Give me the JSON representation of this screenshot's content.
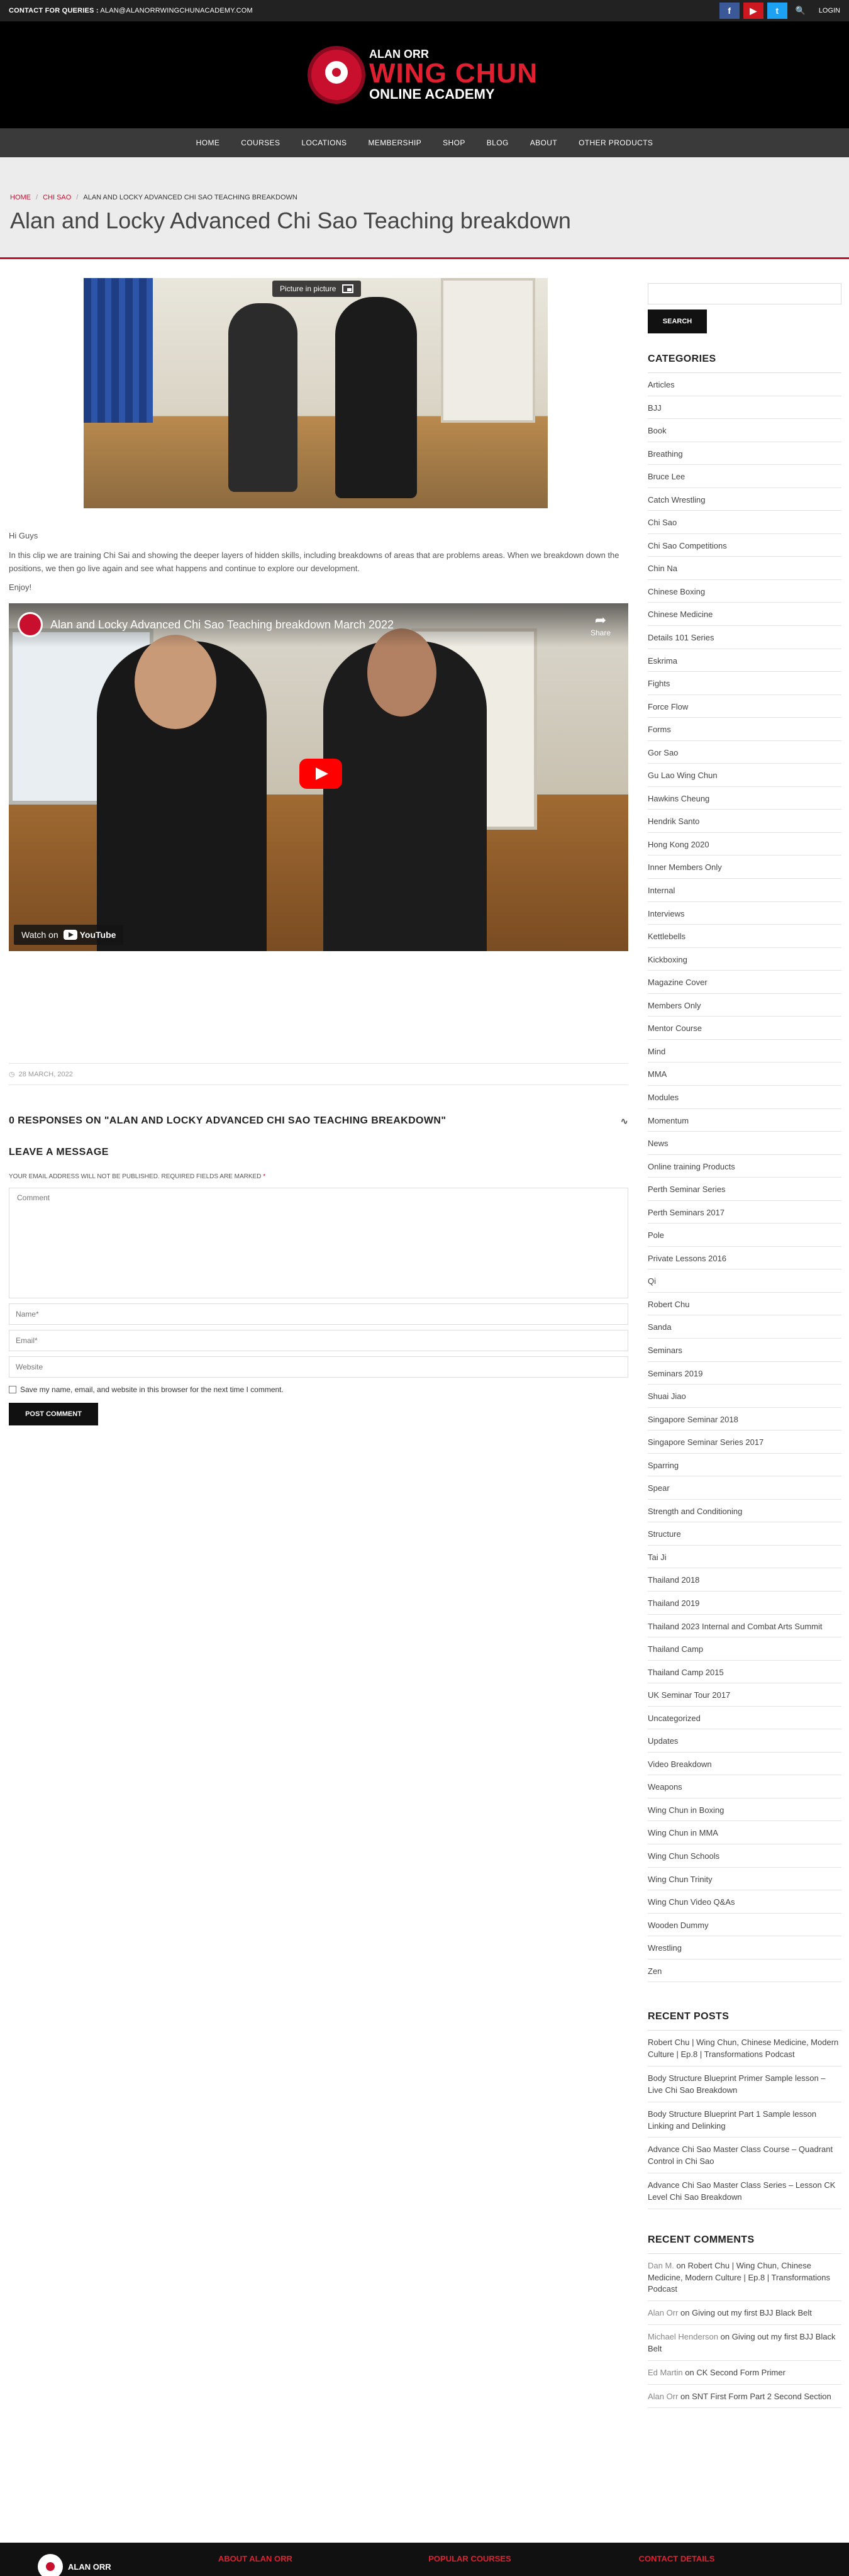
{
  "topbar": {
    "contact_label": "CONTACT FOR QUERIES :",
    "contact_email": "ALAN@ALANORRWINGCHUNACADEMY.COM",
    "social": [
      {
        "name": "facebook",
        "glyph": "f",
        "color": "#3b5998"
      },
      {
        "name": "youtube",
        "glyph": "▶",
        "color": "#cc181e"
      },
      {
        "name": "twitter",
        "glyph": "t",
        "color": "#1da1f2"
      }
    ],
    "login_label": "LOGIN"
  },
  "logo": {
    "line1": "ALAN ORR",
    "line2": "WING CHUN",
    "line3": "ONLINE ACADEMY"
  },
  "nav": [
    "HOME",
    "COURSES",
    "LOCATIONS",
    "MEMBERSHIP",
    "SHOP",
    "BLOG",
    "ABOUT",
    "OTHER PRODUCTS"
  ],
  "breadcrumb": [
    "HOME",
    "CHI SAO",
    "ALAN AND LOCKY ADVANCED CHI SAO TEACHING BREAKDOWN"
  ],
  "page_title": "Alan and Locky Advanced Chi Sao Teaching breakdown",
  "thumbnail": {
    "pip_label": "Picture in picture"
  },
  "post": {
    "greeting": "Hi Guys",
    "body": "In this clip we are training Chi Sai and showing the deeper layers of hidden skills, including breakdowns of areas that are problems areas. When we breakdown down the positions, we then go live again and see what happens and continue to explore our development.",
    "closing": "Enjoy!"
  },
  "video": {
    "title": "Alan and Locky Advanced Chi Sao Teaching breakdown March 2022",
    "share_label": "Share",
    "watch_label": "Watch on",
    "youtube_label": "YouTube"
  },
  "meta": {
    "date": "28 MARCH, 2022"
  },
  "responses": {
    "label": "0 RESPONSES ON \"ALAN AND LOCKY ADVANCED CHI SAO TEACHING BREAKDOWN\""
  },
  "comment_form": {
    "heading": "LEAVE A MESSAGE",
    "note": "YOUR EMAIL ADDRESS WILL NOT BE PUBLISHED. REQUIRED FIELDS ARE MARKED",
    "required_mark": "*",
    "comment_placeholder": "Comment",
    "name_placeholder": "Name*",
    "email_placeholder": "Email*",
    "website_placeholder": "Website",
    "save_label": "Save my name, email, and website in this browser for the next time I comment.",
    "submit_label": "POST COMMENT"
  },
  "sidebar": {
    "search_button": "SEARCH",
    "categories_title": "CATEGORIES",
    "categories": [
      "Articles",
      "BJJ",
      "Book",
      "Breathing",
      "Bruce Lee",
      "Catch Wrestling",
      "Chi Sao",
      "Chi Sao Competitions",
      "Chin Na",
      "Chinese Boxing",
      "Chinese Medicine",
      "Details 101 Series",
      "Eskrima",
      "Fights",
      "Force Flow",
      "Forms",
      "Gor Sao",
      "Gu Lao Wing Chun",
      "Hawkins Cheung",
      "Hendrik Santo",
      "Hong Kong 2020",
      "Inner Members Only",
      "Internal",
      "Interviews",
      "Kettlebells",
      "Kickboxing",
      "Magazine Cover",
      "Members Only",
      "Mentor Course",
      "Mind",
      "MMA",
      "Modules",
      "Momentum",
      "News",
      "Online training Products",
      "Perth Seminar Series",
      "Perth Seminars 2017",
      "Pole",
      "Private Lessons 2016",
      "Qi",
      "Robert Chu",
      "Sanda",
      "Seminars",
      "Seminars 2019",
      "Shuai Jiao",
      "Singapore Seminar 2018",
      "Singapore Seminar Series 2017",
      "Sparring",
      "Spear",
      "Strength and Conditioning",
      "Structure",
      "Tai Ji",
      "Thailand 2018",
      "Thailand 2019",
      "Thailand 2023 Internal and Combat Arts Summit",
      "Thailand Camp",
      "Thailand Camp 2015",
      "UK Seminar Tour 2017",
      "Uncategorized",
      "Updates",
      "Video Breakdown",
      "Weapons",
      "Wing Chun in Boxing",
      "Wing Chun in MMA",
      "Wing Chun Schools",
      "Wing Chun Trinity",
      "Wing Chun Video Q&As",
      "Wooden Dummy",
      "Wrestling",
      "Zen"
    ],
    "recent_posts_title": "RECENT POSTS",
    "recent_posts": [
      "Robert Chu | Wing Chun, Chinese Medicine, Modern Culture | Ep.8 | Transformations Podcast",
      "Body Structure Blueprint Primer Sample lesson – Live Chi Sao Breakdown",
      "Body Structure Blueprint Part 1 Sample lesson Linking and Delinking",
      "Advance Chi Sao Master Class Course – Quadrant Control in Chi Sao",
      "Advance Chi Sao Master Class Series – Lesson CK Level Chi Sao Breakdown"
    ],
    "recent_comments_title": "RECENT COMMENTS",
    "recent_comments": [
      {
        "author": "Dan M.",
        "on": "on",
        "post": "Robert Chu | Wing Chun, Chinese Medicine, Modern Culture | Ep.8 | Transformations Podcast"
      },
      {
        "author": "Alan Orr",
        "on": "on",
        "post": "Giving out my first BJJ Black Belt"
      },
      {
        "author": "Michael Henderson",
        "on": "on",
        "post": "Giving out my first BJJ Black Belt"
      },
      {
        "author": "Ed Martin",
        "on": "on",
        "post": "CK Second Form Primer"
      },
      {
        "author": "Alan Orr",
        "on": "on",
        "post": "SNT First Form Part 2 Second Section"
      }
    ]
  },
  "footer": {
    "logo_text": "ALAN ORR",
    "columns": [
      "ABOUT ALAN ORR",
      "POPULAR COURSES",
      "CONTACT DETAILS"
    ]
  }
}
